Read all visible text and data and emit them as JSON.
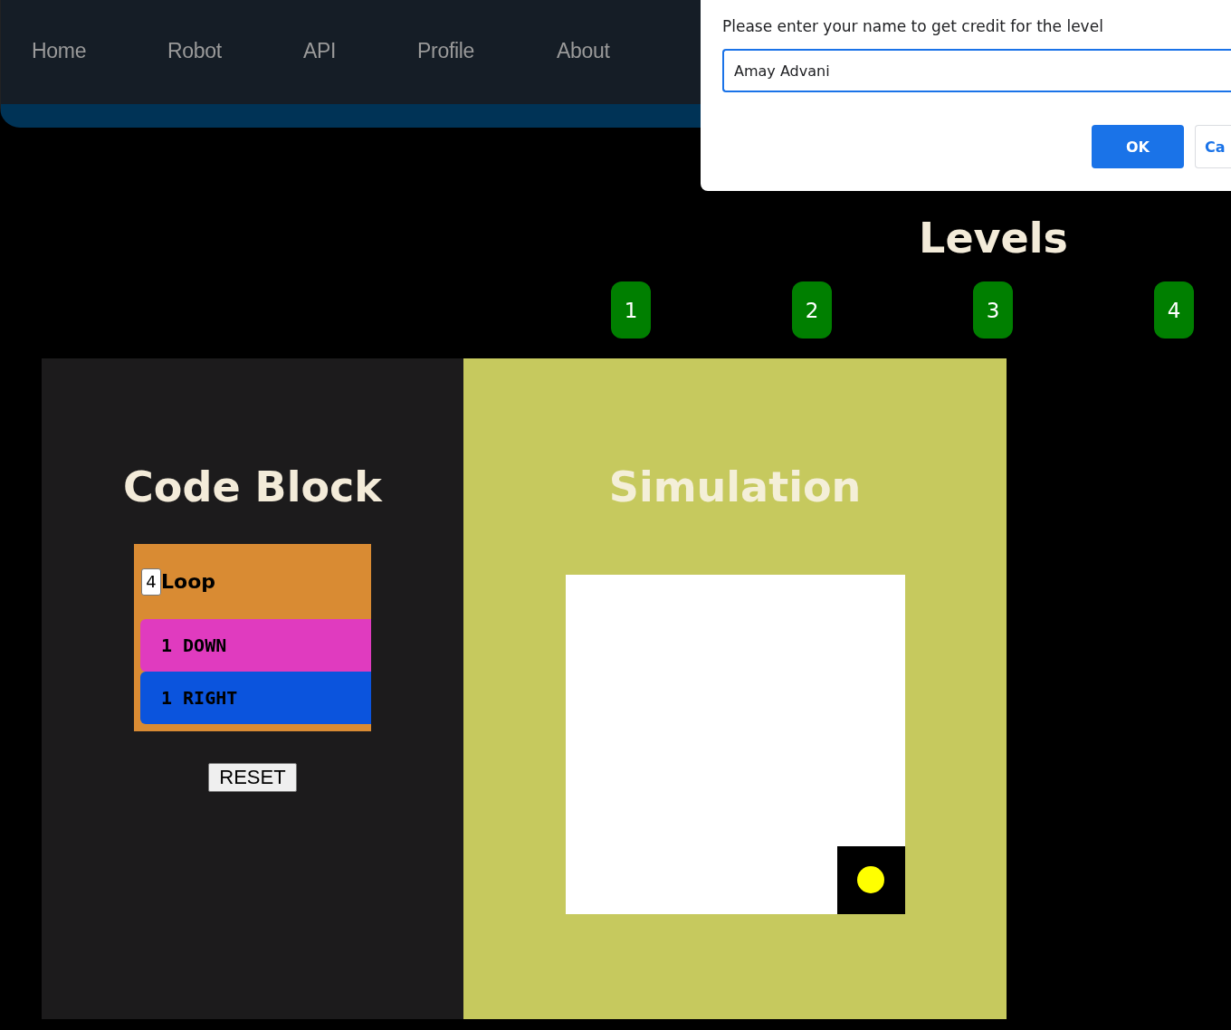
{
  "nav": {
    "items": [
      "Home",
      "Robot",
      "API",
      "Profile",
      "About"
    ]
  },
  "levels": {
    "title": "Levels",
    "buttons": [
      "1",
      "2",
      "3",
      "4"
    ]
  },
  "code_block": {
    "title": "Code Block",
    "loop": {
      "count": "4",
      "label": "Loop",
      "blocks": [
        {
          "count": "1",
          "command": "DOWN",
          "color": "#e03bbf"
        },
        {
          "count": "1",
          "command": "RIGHT",
          "color": "#0b54dd"
        }
      ]
    },
    "reset": "RESET"
  },
  "simulation": {
    "title": "Simulation"
  },
  "dialog": {
    "message": "Please enter your name to get credit for the level",
    "value": "Amay Advani",
    "buttons": [
      {
        "label": "OK",
        "kind": "primary"
      },
      {
        "label": "Ca",
        "kind": "secondary"
      }
    ]
  }
}
